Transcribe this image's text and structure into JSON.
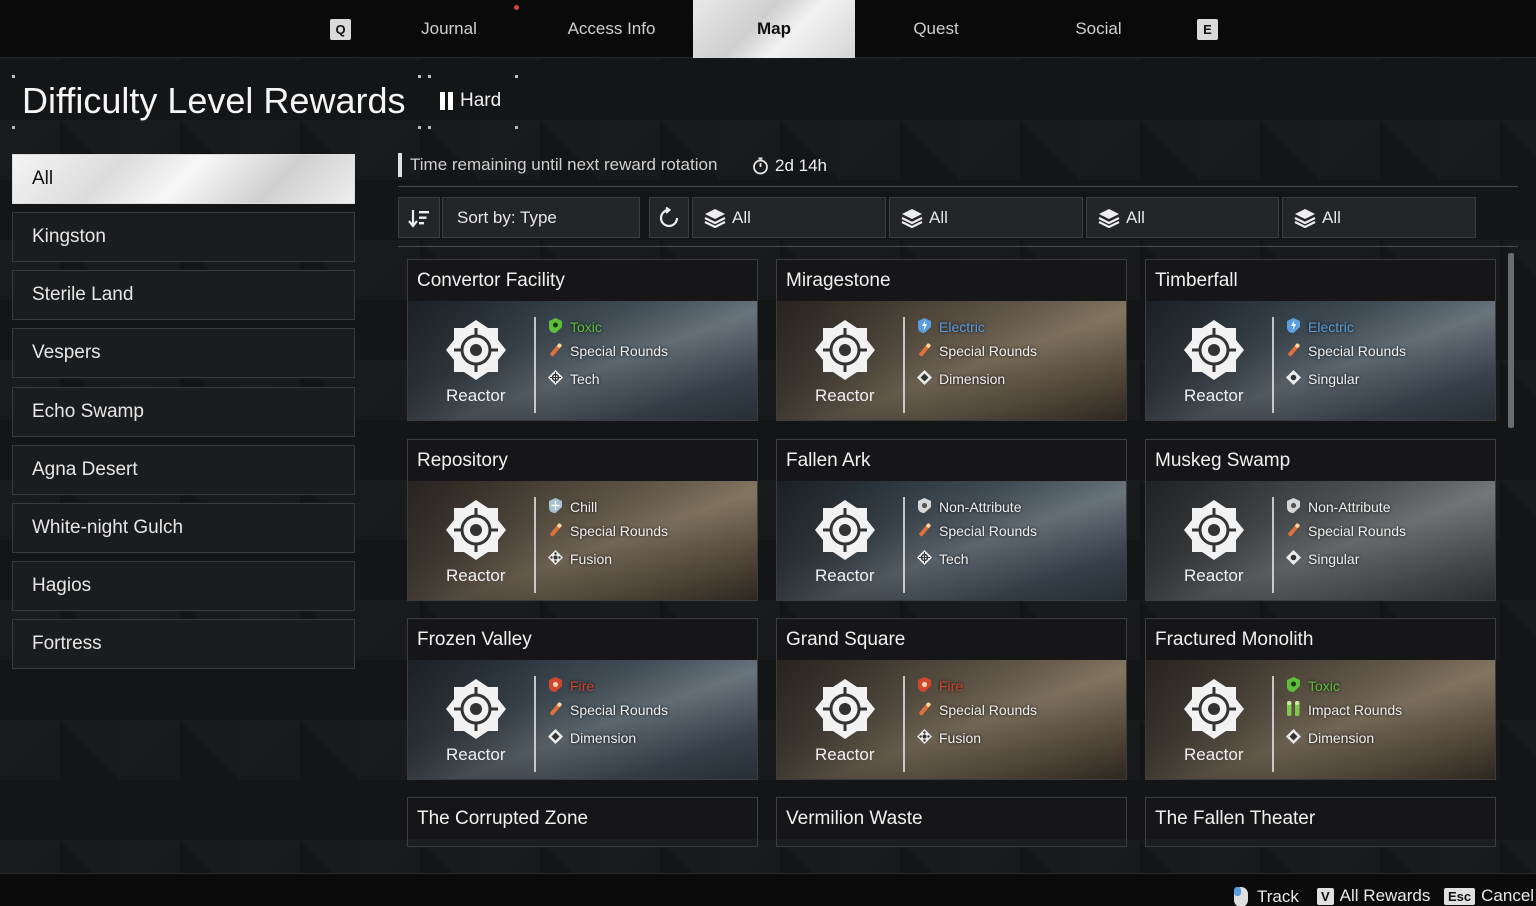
{
  "nav": {
    "left_key": "Q",
    "right_key": "E",
    "tabs": [
      {
        "label": "Journal"
      },
      {
        "label": "Access Info"
      },
      {
        "label": "Map"
      },
      {
        "label": "Quest"
      },
      {
        "label": "Social"
      }
    ],
    "active_tab": "Map"
  },
  "header": {
    "title": "Difficulty Level Rewards",
    "difficulty": "Hard"
  },
  "sidebar": {
    "items": [
      {
        "label": "All"
      },
      {
        "label": "Kingston"
      },
      {
        "label": "Sterile Land"
      },
      {
        "label": "Vespers"
      },
      {
        "label": "Echo Swamp"
      },
      {
        "label": "Agna Desert"
      },
      {
        "label": "White-night Gulch"
      },
      {
        "label": "Hagios"
      },
      {
        "label": "Fortress"
      }
    ],
    "active": "All"
  },
  "timer": {
    "label": "Time remaining until next reward rotation",
    "value": "2d 14h"
  },
  "filters": {
    "sort_label": "Sort by: Type",
    "filter1": "All",
    "filter2": "All",
    "filter3": "All",
    "filter4": "All"
  },
  "colors": {
    "toxic": "#5fbf3c",
    "electric": "#5a9ee0",
    "fire": "#d2452e",
    "chill": "#a8c2d4",
    "rounds": "#e0703a",
    "impact": "#7fc94a"
  },
  "cards": [
    {
      "title": "Convertor Facility",
      "reward": "Reactor",
      "element": "Toxic",
      "element_icon": "toxic-icon",
      "rounds": "Special Rounds",
      "rounds_icon": "special-rounds-icon",
      "arche": "Tech",
      "arche_icon": "tech-icon"
    },
    {
      "title": "Miragestone",
      "reward": "Reactor",
      "element": "Electric",
      "element_icon": "electric-icon",
      "rounds": "Special Rounds",
      "rounds_icon": "special-rounds-icon",
      "arche": "Dimension",
      "arche_icon": "dimension-icon"
    },
    {
      "title": "Timberfall",
      "reward": "Reactor",
      "element": "Electric",
      "element_icon": "electric-icon",
      "rounds": "Special Rounds",
      "rounds_icon": "special-rounds-icon",
      "arche": "Singular",
      "arche_icon": "singular-icon"
    },
    {
      "title": "Repository",
      "reward": "Reactor",
      "element": "Chill",
      "element_icon": "chill-icon",
      "rounds": "Special Rounds",
      "rounds_icon": "special-rounds-icon",
      "arche": "Fusion",
      "arche_icon": "fusion-icon"
    },
    {
      "title": "Fallen Ark",
      "reward": "Reactor",
      "element": "Non-Attribute",
      "element_icon": "non-attribute-icon",
      "rounds": "Special Rounds",
      "rounds_icon": "special-rounds-icon",
      "arche": "Tech",
      "arche_icon": "tech-icon"
    },
    {
      "title": "Muskeg Swamp",
      "reward": "Reactor",
      "element": "Non-Attribute",
      "element_icon": "non-attribute-icon",
      "rounds": "Special Rounds",
      "rounds_icon": "special-rounds-icon",
      "arche": "Singular",
      "arche_icon": "singular-icon"
    },
    {
      "title": "Frozen Valley",
      "reward": "Reactor",
      "element": "Fire",
      "element_icon": "fire-icon",
      "rounds": "Special Rounds",
      "rounds_icon": "special-rounds-icon",
      "arche": "Dimension",
      "arche_icon": "dimension-icon"
    },
    {
      "title": "Grand Square",
      "reward": "Reactor",
      "element": "Fire",
      "element_icon": "fire-icon",
      "rounds": "Special Rounds",
      "rounds_icon": "special-rounds-icon",
      "arche": "Fusion",
      "arche_icon": "fusion-icon"
    },
    {
      "title": "Fractured Monolith",
      "reward": "Reactor",
      "element": "Toxic",
      "element_icon": "toxic-icon",
      "rounds": "Impact Rounds",
      "rounds_icon": "impact-rounds-icon",
      "arche": "Dimension",
      "arche_icon": "dimension-icon"
    }
  ],
  "partial_cards": [
    {
      "title": "The Corrupted Zone"
    },
    {
      "title": "Vermilion Waste"
    },
    {
      "title": "The Fallen Theater"
    }
  ],
  "bottom": {
    "track_label": "Track",
    "all_rewards_key": "V",
    "all_rewards_label": "All Rewards",
    "cancel_key": "Esc",
    "cancel_label": "Cancel"
  }
}
